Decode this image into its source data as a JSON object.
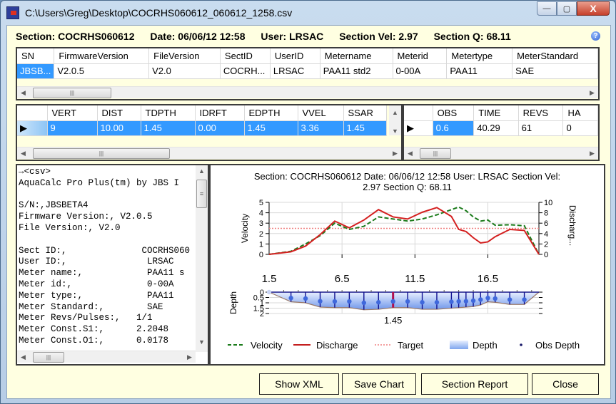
{
  "window": {
    "title": "C:\\Users\\Greg\\Desktop\\COCRHS060612_060612_1258.csv",
    "minimize_label": "—",
    "maximize_label": "▢",
    "close_label": "X"
  },
  "infobar": {
    "section": "Section: COCRHS060612",
    "date": "Date: 06/06/12 12:58",
    "user": "User: LRSAC",
    "section_vel": "Section Vel: 2.97",
    "section_q": "Section Q: 68.11",
    "help_icon": "?"
  },
  "header_grid": {
    "columns": [
      "SN",
      "FirmwareVersion",
      "FileVersion",
      "SectID",
      "UserID",
      "Metername",
      "Meterid",
      "Metertype",
      "MeterStandard"
    ],
    "rows": [
      [
        "JBSB...",
        "V2.0.5",
        "V2.0",
        "COCRH...",
        "LRSAC",
        "PAA11 std2",
        "0-00A",
        "PAA11",
        "SAE"
      ]
    ]
  },
  "vertical_grid": {
    "columns": [
      "VERT",
      "DIST",
      "TDPTH",
      "IDRFT",
      "EDPTH",
      "VVEL",
      "SSAR"
    ],
    "rows": [
      [
        "9",
        "10.00",
        "1.45",
        "0.00",
        "1.45",
        "3.36",
        "1.45"
      ]
    ]
  },
  "obs_grid": {
    "columns": [
      "OBS",
      "TIME",
      "REVS",
      "HA"
    ],
    "rows": [
      [
        "0.6",
        "40.29",
        "61",
        "0"
      ]
    ]
  },
  "csv_text": {
    "lines": [
      "→<csv>",
      "AquaCalc Pro Plus(tm) by JBS I",
      "",
      "S/N:,JBSBETA4",
      "Firmware Version:, V2.0.5",
      "File Version:, V2.0",
      "",
      "Sect ID:,              COCRHS060",
      "User ID:,               LRSAC",
      "Meter name:,            PAA11 s",
      "Meter id:,              0-00A",
      "Meter type:,            PAA11",
      "Meter Standard:,        SAE",
      "Meter Revs/Pulses:,   1/1",
      "Meter Const.S1:,      2.2048",
      "Meter Const.O1:,      0.0178"
    ]
  },
  "buttons": {
    "show_xml": "Show XML",
    "save_chart": "Save Chart",
    "section_report": "Section Report",
    "close": "Close"
  },
  "chart_data": [
    {
      "type": "line",
      "title": "Section: COCRHS060612    Date: 06/06/12 12:58    User: LRSAC    Section Vel: 2.97    Section Q: 68.11",
      "title_line1": "Section: COCRHS060612    Date: 06/06/12 12:58    User: LRSAC    Section Vel:",
      "title_line2": "2.97    Section Q: 68.11",
      "ylabel": "Velocity",
      "y2label": "Discharg...",
      "ylim": [
        0,
        5
      ],
      "y2lim": [
        0,
        10
      ],
      "yticks": [
        "0",
        "1",
        "2",
        "3",
        "4",
        "5"
      ],
      "y2ticks": [
        "0",
        "2",
        "4",
        "6",
        "8",
        "10"
      ],
      "xlim": [
        1.5,
        20
      ],
      "grid": true,
      "x": [
        1.5,
        3,
        4,
        5,
        6,
        7,
        8,
        9,
        10,
        11,
        12,
        13,
        14,
        14.5,
        15,
        15.5,
        16,
        16.5,
        17,
        18,
        19,
        20
      ],
      "series": [
        {
          "name": "Velocity",
          "axis": "left",
          "color": "#1a7a1a",
          "style": "dashed",
          "values": [
            0,
            0.3,
            1.0,
            1.8,
            3.0,
            2.4,
            2.7,
            3.6,
            3.4,
            3.2,
            3.4,
            3.8,
            4.3,
            4.55,
            4.2,
            3.6,
            3.2,
            3.3,
            2.8,
            2.85,
            2.75,
            0
          ]
        },
        {
          "name": "Discharge",
          "axis": "right",
          "color": "#d42020",
          "style": "solid",
          "values": [
            0,
            0.5,
            1.6,
            3.8,
            6.4,
            5.1,
            6.6,
            8.6,
            7.2,
            6.8,
            8.1,
            9.0,
            7.3,
            4.8,
            4.4,
            3.2,
            2.2,
            2.4,
            3.4,
            4.8,
            4.6,
            0
          ]
        },
        {
          "name": "Target",
          "axis": "left",
          "color": "#f08080",
          "style": "dotted",
          "value": 2.5
        }
      ]
    },
    {
      "type": "area",
      "ylabel": "Depth",
      "ylim": [
        0,
        2
      ],
      "yticks": [
        "0",
        "0.5",
        "1",
        "1.5",
        "2"
      ],
      "xticks": [
        "1.5",
        "6.5",
        "11.5",
        "16.5"
      ],
      "xlim": [
        1.5,
        20
      ],
      "selected_x": 10,
      "selected_label": "1.45",
      "x": [
        1.5,
        3,
        4,
        5,
        6,
        7,
        8,
        9,
        10,
        11,
        12,
        13,
        14,
        14.5,
        15,
        15.5,
        16,
        16.5,
        17,
        18,
        19,
        20
      ],
      "depth": [
        0,
        0.9,
        1.0,
        1.4,
        1.45,
        1.45,
        1.65,
        1.6,
        1.45,
        1.45,
        1.6,
        1.6,
        1.5,
        1.45,
        1.4,
        1.35,
        1.2,
        0.9,
        0.95,
        1.15,
        1.15,
        0
      ],
      "obs_depth": [
        0,
        0.55,
        0.6,
        0.85,
        0.87,
        0.87,
        1.0,
        0.95,
        0.87,
        0.87,
        0.95,
        0.95,
        0.9,
        0.87,
        0.85,
        0.8,
        0.7,
        0.55,
        0.6,
        0.7,
        0.7,
        null
      ],
      "legend": [
        {
          "name": "Velocity",
          "color": "#1a7a1a",
          "style": "dashed"
        },
        {
          "name": "Discharge",
          "color": "#c41e1e",
          "style": "solid"
        },
        {
          "name": "Target",
          "color": "#f08080",
          "style": "dotted"
        },
        {
          "name": "Depth",
          "color": "#7fa6ee",
          "style": "area"
        },
        {
          "name": "Obs Depth",
          "color": "#1a1a6a",
          "style": "marker"
        }
      ]
    }
  ]
}
